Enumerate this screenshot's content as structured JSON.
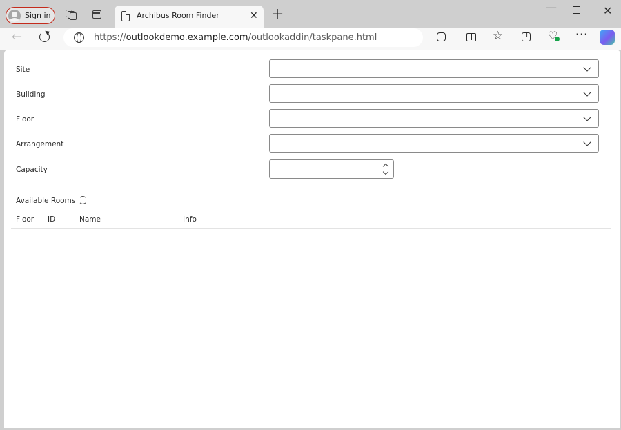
{
  "browser": {
    "sign_in_label": "Sign in",
    "tab_title": "Archibus Room Finder",
    "tab_close": "✕",
    "new_tab": "+",
    "window_controls": {
      "minimize": "—",
      "close": "✕"
    },
    "url": {
      "scheme": "https://",
      "host": "outlookdemo.example.com",
      "path": "/outlookaddin/taskpane.html"
    },
    "nav": {
      "back": "←",
      "favorites": "☆",
      "health": "♡",
      "more": "···"
    }
  },
  "form": {
    "fields": [
      {
        "label": "Site",
        "value": ""
      },
      {
        "label": "Building",
        "value": ""
      },
      {
        "label": "Floor",
        "value": ""
      },
      {
        "label": "Arrangement",
        "value": ""
      }
    ],
    "capacity": {
      "label": "Capacity",
      "value": ""
    }
  },
  "rooms": {
    "title": "Available Rooms",
    "columns": [
      "Floor",
      "ID",
      "Name",
      "Info"
    ],
    "rows": []
  },
  "colors": {
    "chrome_bg": "#cfcfcf",
    "toolbar_bg": "#f7f7f7",
    "signin_border": "#c42b1c",
    "content_bg": "#ffffff"
  }
}
